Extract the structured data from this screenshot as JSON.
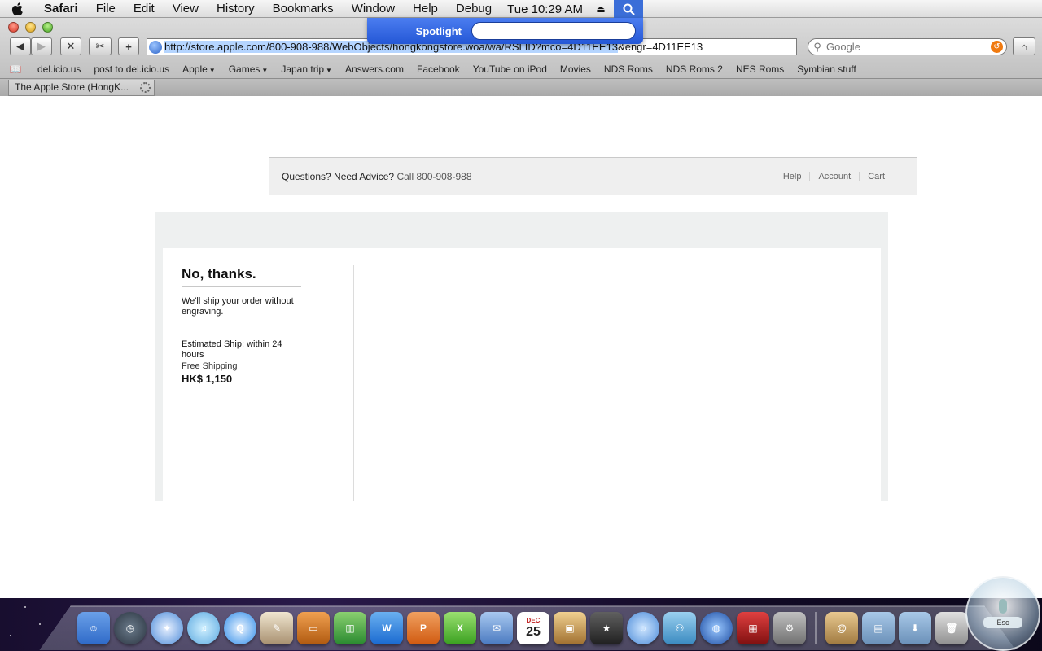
{
  "menubar": {
    "app_name": "Safari",
    "items": [
      "File",
      "Edit",
      "View",
      "History",
      "Bookmarks",
      "Window",
      "Help",
      "Debug"
    ],
    "clock": "Tue 10:29 AM"
  },
  "spotlight": {
    "label": "Spotlight",
    "value": ""
  },
  "toolbar": {
    "url_selected": "http://store.apple.com/800-908-988/WebObjects/hongkongstore.woa/wa/RSLID?mco=4D11EE13",
    "url_rest": "&engr=4D11EE13",
    "search_placeholder": "Google"
  },
  "bookmarks": [
    {
      "label": "del.icio.us",
      "menu": false
    },
    {
      "label": "post to del.icio.us",
      "menu": false
    },
    {
      "label": "Apple",
      "menu": true
    },
    {
      "label": "Games",
      "menu": true
    },
    {
      "label": "Japan trip",
      "menu": true
    },
    {
      "label": "Answers.com",
      "menu": false
    },
    {
      "label": "Facebook",
      "menu": false
    },
    {
      "label": "YouTube on iPod",
      "menu": false
    },
    {
      "label": "Movies",
      "menu": false
    },
    {
      "label": "NDS Roms",
      "menu": false
    },
    {
      "label": "NDS Roms 2",
      "menu": false
    },
    {
      "label": "NES Roms",
      "menu": false
    },
    {
      "label": "Symbian stuff",
      "menu": false
    }
  ],
  "tab": {
    "title": "The Apple Store (HongK..."
  },
  "store": {
    "advice_prefix": "Questions? Need Advice?",
    "advice_call": "Call 800-908-988",
    "nav": [
      "Help",
      "Account",
      "Cart"
    ]
  },
  "engraving_option": {
    "title": "No, thanks.",
    "description": "We'll ship your order without engraving.",
    "estimated_ship": "Estimated Ship: within 24 hours",
    "shipping": "Free Shipping",
    "price": "HK$ 1,150"
  },
  "dock": {
    "esc_label": "Esc",
    "calendar_month": "DEC",
    "calendar_day": "25"
  }
}
